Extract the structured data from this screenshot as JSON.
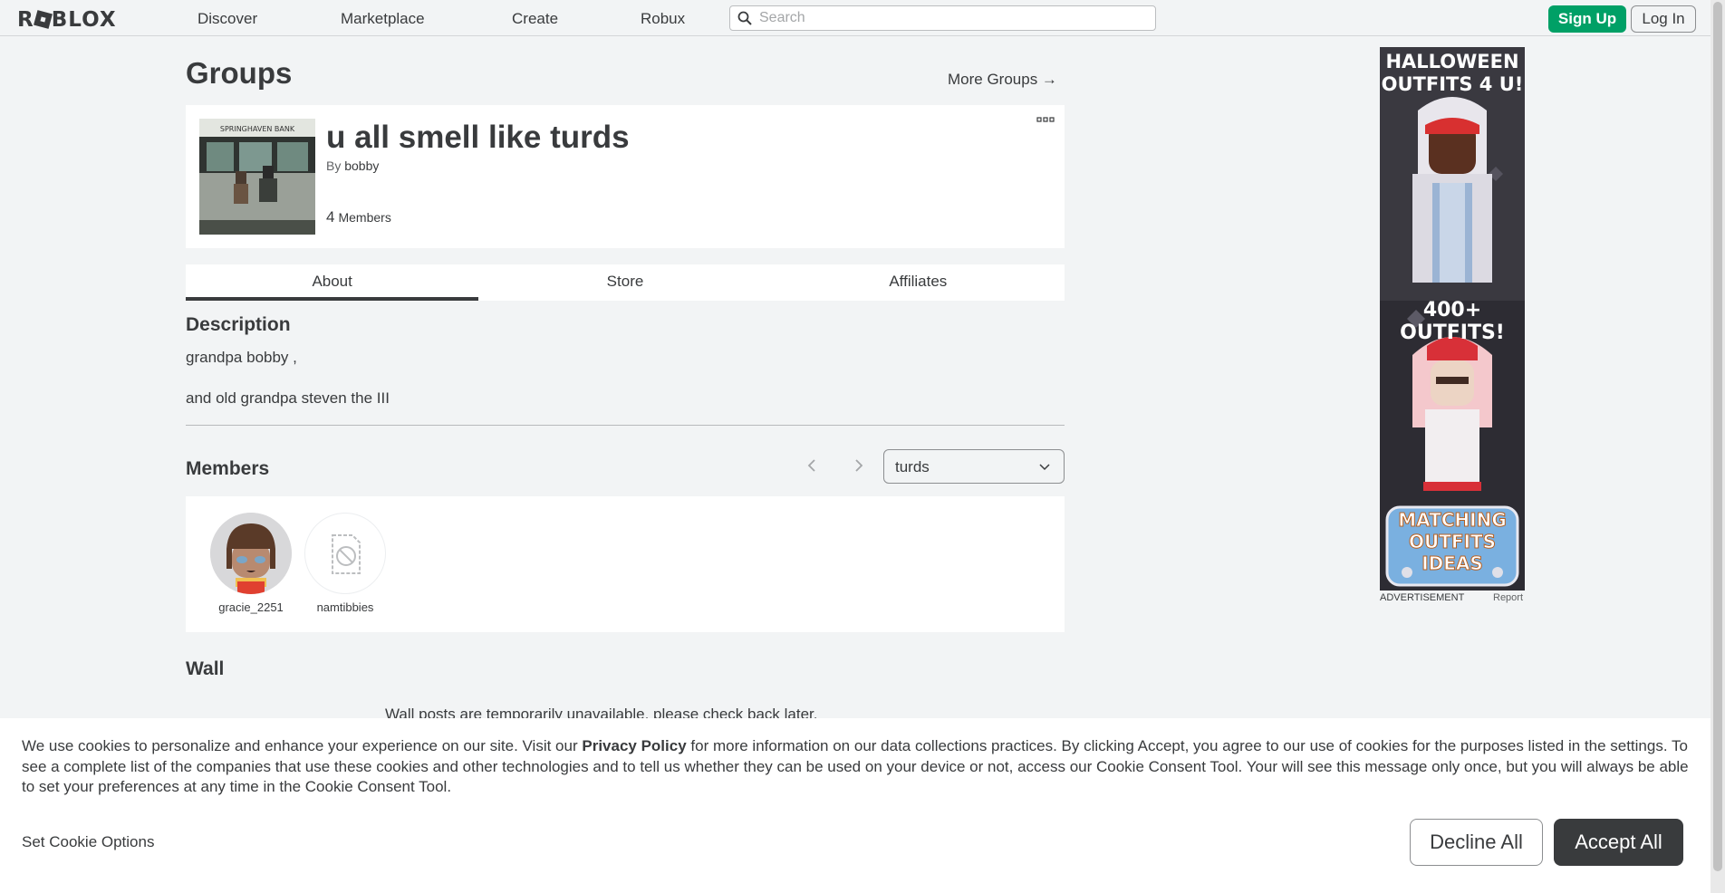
{
  "header": {
    "logo_text": "ROBLOX",
    "nav": [
      "Discover",
      "Marketplace",
      "Create",
      "Robux"
    ],
    "search_placeholder": "Search",
    "signup_label": "Sign Up",
    "login_label": "Log In"
  },
  "page": {
    "title": "Groups",
    "more_groups_label": "More Groups →"
  },
  "group": {
    "name": "u all smell like turds",
    "by_label": "By",
    "owner": "bobby",
    "member_count": "4",
    "members_label": "Members"
  },
  "tabs": [
    {
      "label": "About",
      "active": true
    },
    {
      "label": "Store",
      "active": false
    },
    {
      "label": "Affiliates",
      "active": false
    }
  ],
  "description": {
    "heading": "Description",
    "line1": "grandpa bobby ,",
    "line2": "and old grandpa steven the III"
  },
  "members_section": {
    "heading": "Members",
    "role_selected": "turds",
    "members": [
      {
        "name": "gracie_2251",
        "has_avatar": true
      },
      {
        "name": "namtibbies",
        "has_avatar": false
      }
    ]
  },
  "wall": {
    "heading": "Wall",
    "message": "Wall posts are temporarily unavailable, please check back later."
  },
  "ad": {
    "headline": "HALLOWEEN OUTFITS 4 U!",
    "subhead": "400+ OUTFITS!",
    "badge": "MATCHING OUTFITS IDEAS",
    "label": "ADVERTISEMENT",
    "report": "Report"
  },
  "cookie_banner": {
    "text_before": "We use cookies to personalize and enhance your experience on our site. Visit our ",
    "privacy_link": "Privacy Policy",
    "text_after": " for more information on our data collections practices. By clicking Accept, you agree to our use of cookies for the purposes listed in the settings. To see a complete list of the companies that use these cookies and other technologies and to tell us whether they can be used on your device or not, access our Cookie Consent Tool. Your will see this message only once, but you will always be able to set your preferences at any time in the Cookie Consent Tool.",
    "set_options_label": "Set Cookie Options",
    "decline_label": "Decline All",
    "accept_label": "Accept All"
  },
  "colors": {
    "background": "#f2f4f5",
    "text": "#393b3d",
    "signup_green": "#00a066",
    "accept_dark": "#393b3d"
  }
}
